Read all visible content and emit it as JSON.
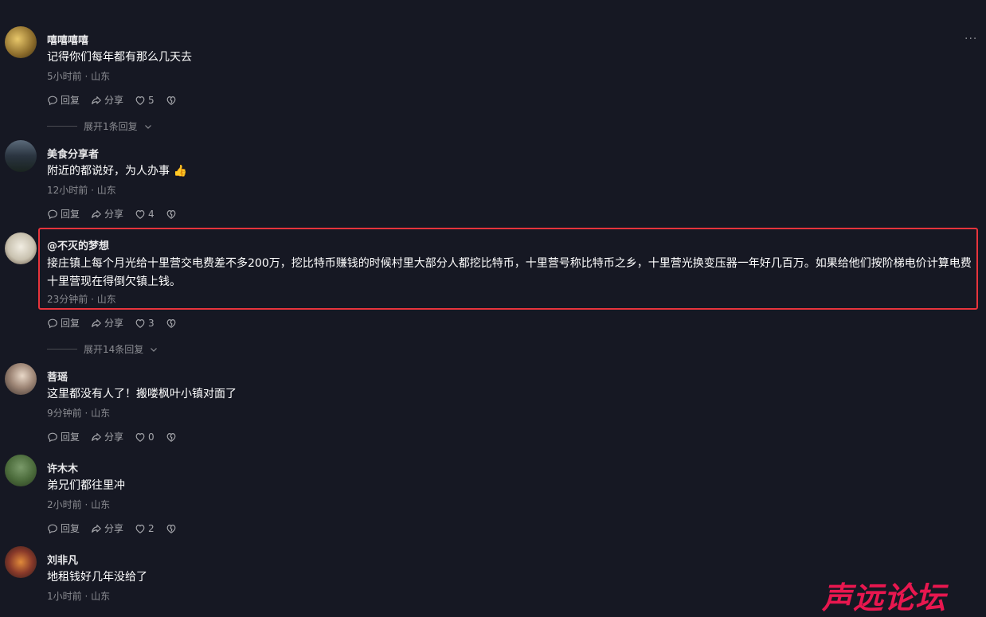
{
  "comments": [
    {
      "username": "嘻嘻嘻嘻",
      "text": "记得你们每年都有那么几天去",
      "meta": "5小时前 · 山东",
      "reply_label": "回复",
      "share_label": "分享",
      "likes": "5",
      "expand_label": "展开1条回复"
    },
    {
      "username": "美食分享者",
      "text": "附近的都说好，为人办事 👍",
      "meta": "12小时前 · 山东",
      "reply_label": "回复",
      "share_label": "分享",
      "likes": "4"
    },
    {
      "username": "@不灭的梦想",
      "text_line1": "接庄镇上每个月光给十里营交电费差不多200万，挖比特币赚钱的时候村里大部分人都挖比特币，十里营号称比特币之乡，十里营光换变压器一年好几百万。如果给他们按阶梯电价计算电费",
      "text_line2": "十里营现在得倒欠镇上钱。",
      "meta": "23分钟前 · 山东",
      "reply_label": "回复",
      "share_label": "分享",
      "likes": "3",
      "expand_label": "展开14条回复"
    },
    {
      "username": "菩瑶",
      "text": "这里都没有人了！搬喽枫叶小镇对面了",
      "meta": "9分钟前 · 山东",
      "reply_label": "回复",
      "share_label": "分享",
      "likes": "0"
    },
    {
      "username": "许木木",
      "text": "弟兄们都往里冲",
      "meta": "2小时前 · 山东",
      "reply_label": "回复",
      "share_label": "分享",
      "likes": "2"
    },
    {
      "username": "刘非凡",
      "text": "地租钱好几年没给了",
      "meta": "1小时前 · 山东"
    }
  ],
  "more_label": "···",
  "watermark": "声远论坛",
  "colors": {
    "background": "#161823",
    "highlight": "#e8343c",
    "watermark": "#e8174f"
  }
}
